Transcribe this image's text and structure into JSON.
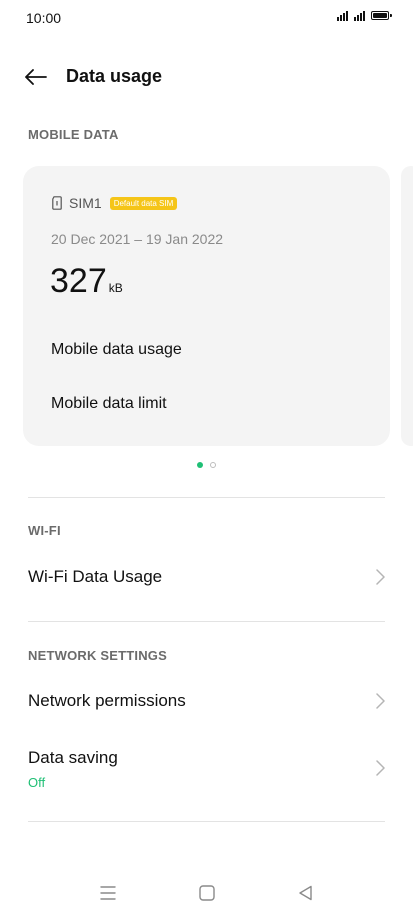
{
  "status_bar": {
    "time": "10:00"
  },
  "header": {
    "title": "Data usage"
  },
  "mobile_data": {
    "section_label": "MOBILE DATA",
    "card": {
      "sim_name": "SIM1",
      "sim_badge": "Default data SIM",
      "date_range": "20 Dec 2021 – 19 Jan 2022",
      "usage_value": "327",
      "usage_unit": "kB",
      "rows": [
        "Mobile data usage",
        "Mobile data limit"
      ]
    },
    "pager": {
      "pages": 2,
      "current": 1
    }
  },
  "wifi": {
    "section_label": "WI-FI",
    "items": [
      {
        "label": "Wi-Fi Data Usage"
      }
    ]
  },
  "network_settings": {
    "section_label": "NETWORK SETTINGS",
    "items": [
      {
        "label": "Network permissions"
      },
      {
        "label": "Data saving",
        "value": "Off"
      }
    ]
  },
  "colors": {
    "accent": "#1fbf75",
    "badge": "#f5c518"
  },
  "icons": {
    "back": "arrow-left-icon",
    "chevron": "chevron-right-icon",
    "sim": "sim-card-icon",
    "nav": [
      "menu-icon",
      "home-icon",
      "back-triangle-icon"
    ]
  }
}
